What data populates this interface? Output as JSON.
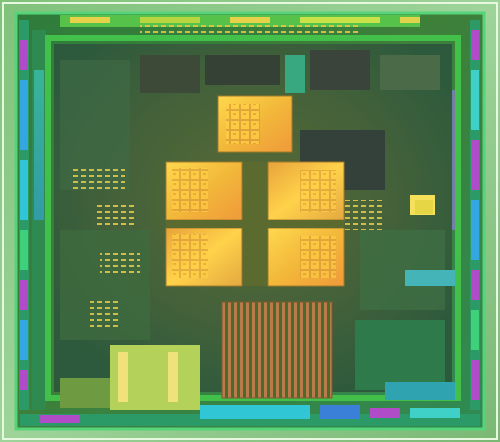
{
  "image": {
    "subject": "die-shot",
    "colors": {
      "frame": "#6fb56f",
      "frame_light": "#d7f0c7",
      "die_base": "#2e7a3c",
      "die_edge": "#3fc06a",
      "core_area": "#4a6b3a",
      "cache_gold": "#e6b430",
      "cache_bright": "#ffd34a",
      "cyan_pads": "#31c6d6",
      "magenta_pads": "#b04cc7",
      "blue_pads": "#3a7fd8",
      "dark_block": "#34403a",
      "copper": "#b5744a"
    }
  }
}
